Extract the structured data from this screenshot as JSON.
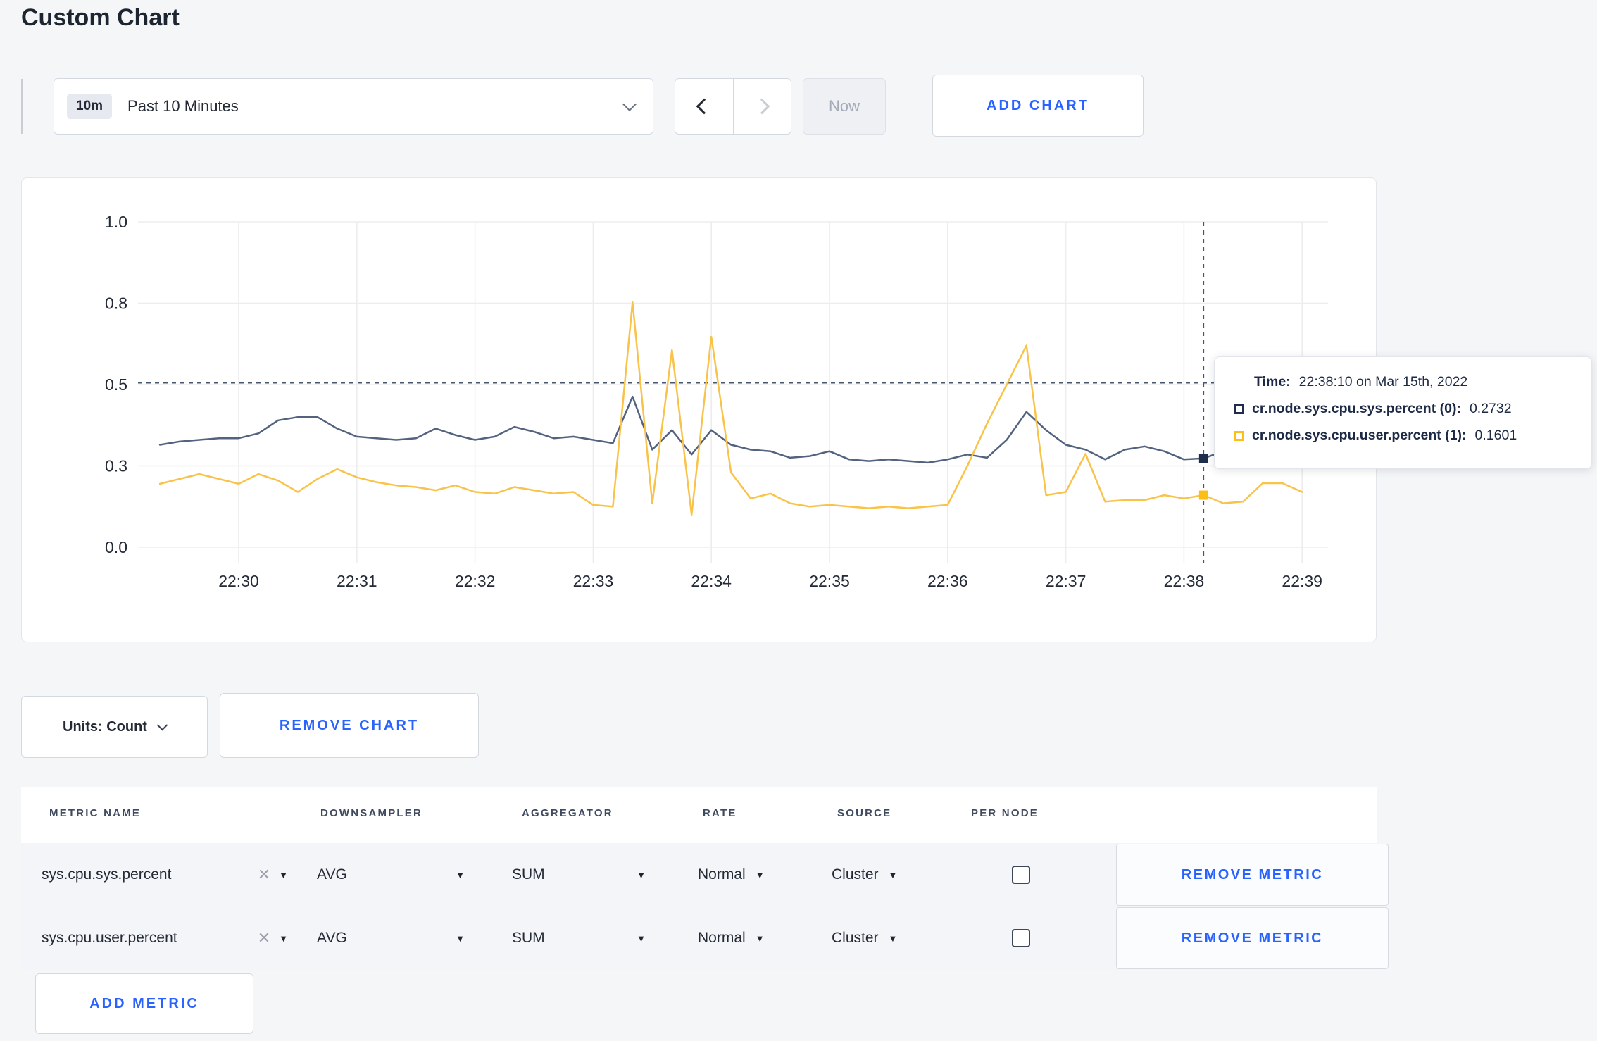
{
  "page": {
    "title": "Custom Chart"
  },
  "toolbar": {
    "range_badge": "10m",
    "range_label": "Past 10 Minutes",
    "now_label": "Now",
    "add_chart_label": "ADD CHART"
  },
  "chart_controls": {
    "units_label": "Units: Count",
    "remove_chart_label": "REMOVE CHART"
  },
  "colors": {
    "accent": "#2962ff",
    "grid": "#ededef",
    "axis_text": "#242a35",
    "crosshair": "#44546b",
    "series_sys_line": "#53637f",
    "series_sys_swatch": "#1f2d4d",
    "series_user_line": "#f9c349",
    "series_user_swatch": "#fdbe18"
  },
  "chart_data": {
    "type": "line",
    "title": "",
    "xlabel": "",
    "ylabel": "",
    "ylim": [
      0,
      1
    ],
    "grid": true,
    "x_start": "22:29:20",
    "x_interval_seconds": 10,
    "x_ticks": [
      "22:30",
      "22:31",
      "22:32",
      "22:33",
      "22:34",
      "22:35",
      "22:36",
      "22:37",
      "22:38",
      "22:39"
    ],
    "y_ticks": [
      {
        "v": 0.0,
        "label": "0.0"
      },
      {
        "v": 0.25,
        "label": "0.3"
      },
      {
        "v": 0.5,
        "label": "0.5"
      },
      {
        "v": 0.75,
        "label": "0.8"
      },
      {
        "v": 1.0,
        "label": "1.0"
      }
    ],
    "series": [
      {
        "name": "cr.node.sys.cpu.sys.percent",
        "line_color": "#53637f",
        "swatch_color": "#1f2d4d",
        "values": [
          0.315,
          0.325,
          0.33,
          0.335,
          0.335,
          0.35,
          0.39,
          0.4,
          0.4,
          0.365,
          0.34,
          0.335,
          0.33,
          0.335,
          0.365,
          0.345,
          0.33,
          0.34,
          0.37,
          0.355,
          0.335,
          0.34,
          0.33,
          0.32,
          0.463,
          0.3,
          0.36,
          0.285,
          0.36,
          0.315,
          0.3,
          0.295,
          0.275,
          0.28,
          0.295,
          0.27,
          0.265,
          0.27,
          0.265,
          0.26,
          0.27,
          0.285,
          0.275,
          0.33,
          0.416,
          0.36,
          0.315,
          0.3,
          0.27,
          0.3,
          0.31,
          0.295,
          0.27,
          0.2732,
          0.295,
          0.31,
          0.295,
          0.285,
          0.3
        ]
      },
      {
        "name": "cr.node.sys.cpu.user.percent",
        "line_color": "#f9c349",
        "swatch_color": "#fdbe18",
        "values": [
          0.195,
          0.21,
          0.225,
          0.21,
          0.195,
          0.225,
          0.205,
          0.17,
          0.21,
          0.24,
          0.215,
          0.2,
          0.19,
          0.185,
          0.175,
          0.19,
          0.17,
          0.165,
          0.185,
          0.175,
          0.165,
          0.17,
          0.13,
          0.125,
          0.753,
          0.135,
          0.606,
          0.1,
          0.647,
          0.23,
          0.15,
          0.165,
          0.135,
          0.125,
          0.13,
          0.125,
          0.12,
          0.125,
          0.12,
          0.125,
          0.13,
          0.25,
          0.38,
          0.5,
          0.62,
          0.16,
          0.17,
          0.287,
          0.14,
          0.145,
          0.145,
          0.16,
          0.15,
          0.1601,
          0.135,
          0.14,
          0.197,
          0.197,
          0.17
        ]
      }
    ],
    "crosshair": {
      "time": "22:38:10",
      "offset_seconds": 530,
      "hover_value": 0.505,
      "point_values": [
        0.2732,
        0.1601
      ]
    },
    "legend_position": "tooltip"
  },
  "tooltip": {
    "time_label": "Time:",
    "time_value": "22:38:10 on Mar 15th, 2022",
    "rows": [
      {
        "label": "cr.node.sys.cpu.sys.percent (0):",
        "value": "0.2732",
        "swatch_color": "#1f2d4d"
      },
      {
        "label": "cr.node.sys.cpu.user.percent (1):",
        "value": "0.1601",
        "swatch_color": "#fdbe18"
      }
    ]
  },
  "metrics_table": {
    "headers": [
      "METRIC NAME",
      "DOWNSAMPLER",
      "AGGREGATOR",
      "RATE",
      "SOURCE",
      "PER NODE"
    ],
    "rows": [
      {
        "metric": "sys.cpu.sys.percent",
        "downsampler": "AVG",
        "aggregator": "SUM",
        "rate": "Normal",
        "source": "Cluster",
        "per_node_checked": false,
        "remove_label": "REMOVE METRIC"
      },
      {
        "metric": "sys.cpu.user.percent",
        "downsampler": "AVG",
        "aggregator": "SUM",
        "rate": "Normal",
        "source": "Cluster",
        "per_node_checked": false,
        "remove_label": "REMOVE METRIC"
      }
    ],
    "add_metric_label": "ADD METRIC"
  }
}
